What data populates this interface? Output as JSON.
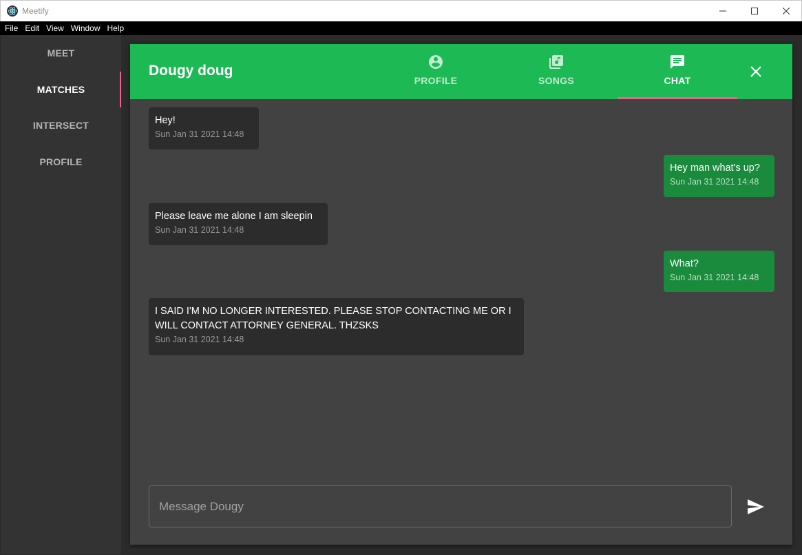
{
  "window": {
    "title": "Meetify"
  },
  "menu": [
    "File",
    "Edit",
    "View",
    "Window",
    "Help"
  ],
  "sidebar": {
    "items": [
      {
        "label": "MEET",
        "active": false
      },
      {
        "label": "MATCHES",
        "active": true
      },
      {
        "label": "INTERSECT",
        "active": false
      },
      {
        "label": "PROFILE",
        "active": false
      }
    ]
  },
  "header": {
    "title": "Dougy doug",
    "tabs": [
      {
        "label": "PROFILE",
        "icon": "account-circle-icon"
      },
      {
        "label": "SONGS",
        "icon": "library-music-icon"
      },
      {
        "label": "CHAT",
        "icon": "chat-icon",
        "active": true
      }
    ]
  },
  "messages": [
    {
      "direction": "in",
      "text": "Hey!",
      "time": "Sun Jan 31 2021 14:48"
    },
    {
      "direction": "out",
      "text": "Hey man what's up?",
      "time": "Sun Jan 31 2021 14:48"
    },
    {
      "direction": "in",
      "text": "Please leave me alone I am sleepin",
      "time": "Sun Jan 31 2021 14:48"
    },
    {
      "direction": "out",
      "text": "What?",
      "time": "Sun Jan 31 2021 14:48"
    },
    {
      "direction": "in",
      "text": "I SAID I'M NO LONGER INTERESTED. PLEASE STOP CONTACTING ME OR I WILL CONTACT ATTORNEY GENERAL. THZSKS",
      "time": "Sun Jan 31 2021 14:48"
    }
  ],
  "composer": {
    "placeholder": "Message Dougy",
    "value": ""
  },
  "colors": {
    "accent_green": "#1db954",
    "outgoing_bubble": "#1a8a3c",
    "indicator_pink": "#f06292"
  }
}
